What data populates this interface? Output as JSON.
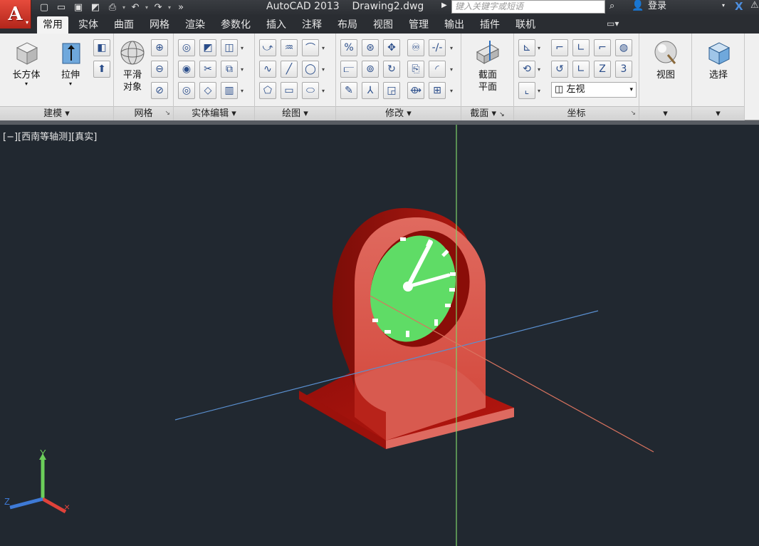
{
  "app": {
    "logo": "A",
    "title": "AutoCAD 2013    Drawing2.dwg",
    "search_placeholder": "键入关键字或短语",
    "login": "登录"
  },
  "qat": [
    "new-icon",
    "open-icon",
    "save-icon",
    "save-as-icon",
    "plot-icon",
    "undo-icon",
    "redo-icon"
  ],
  "tabs": [
    {
      "label": "常用",
      "active": true
    },
    {
      "label": "实体"
    },
    {
      "label": "曲面"
    },
    {
      "label": "网格"
    },
    {
      "label": "渲染"
    },
    {
      "label": "参数化"
    },
    {
      "label": "插入"
    },
    {
      "label": "注释"
    },
    {
      "label": "布局"
    },
    {
      "label": "视图"
    },
    {
      "label": "管理"
    },
    {
      "label": "输出"
    },
    {
      "label": "插件"
    },
    {
      "label": "联机"
    }
  ],
  "panels": {
    "modeling": {
      "title": "建模",
      "box": "长方体",
      "extrude": "拉伸"
    },
    "mesh": {
      "title": "网格",
      "smooth_line1": "平滑",
      "smooth_line2": "对象"
    },
    "solid_edit": {
      "title": "实体编辑"
    },
    "draw": {
      "title": "绘图"
    },
    "modify": {
      "title": "修改"
    },
    "section": {
      "title": "截面",
      "plane_line1": "截面",
      "plane_line2": "平面"
    },
    "coordinates": {
      "title": "坐标",
      "view_combo": "左视"
    },
    "view": {
      "label": "视图"
    },
    "selection": {
      "label": "选择"
    }
  },
  "viewport": {
    "label": "[−][西南等轴测][真实]",
    "ucs": {
      "y": "Y",
      "z": "Z"
    }
  },
  "colors": {
    "clock_body": "#b0150f",
    "clock_face": "#5fdc66",
    "axis_green": "#7ed36a",
    "axis_blue": "#5a8fcf",
    "axis_red": "#d9735f",
    "background": "#212830"
  }
}
